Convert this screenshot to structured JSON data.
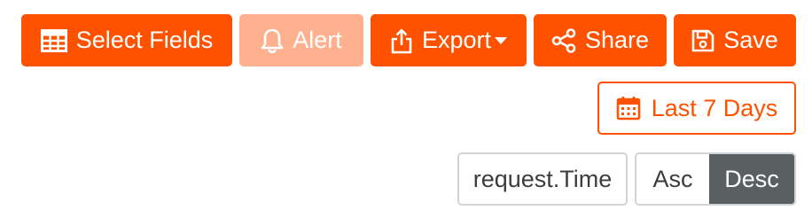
{
  "colors": {
    "accent": "#fe5200",
    "accent_disabled": "#feb08f",
    "selected_segment": "#5a6062",
    "border_gray": "#d0d4d7"
  },
  "toolbar": {
    "select_fields": {
      "label": "Select Fields",
      "icon": "table-icon"
    },
    "alert": {
      "label": "Alert",
      "icon": "bell-icon",
      "disabled": true
    },
    "export": {
      "label": "Export",
      "icon": "upload-icon",
      "has_dropdown": true
    },
    "share": {
      "label": "Share",
      "icon": "share-icon"
    },
    "save": {
      "label": "Save",
      "icon": "floppy-disk-icon"
    }
  },
  "date_range": {
    "label": "Last 7 Days",
    "icon": "calendar-icon"
  },
  "sort": {
    "field": "request.Time",
    "options": [
      "Asc",
      "Desc"
    ],
    "selected": "Desc"
  }
}
